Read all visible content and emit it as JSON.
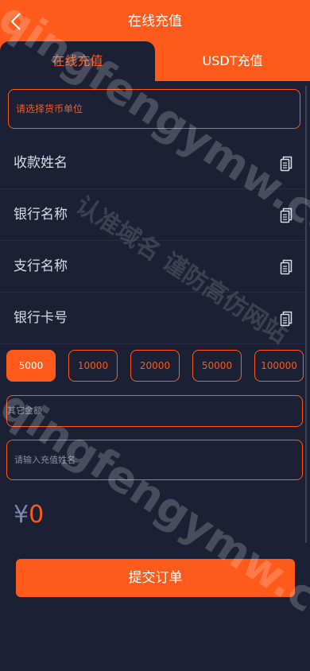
{
  "header": {
    "title": "在线充值",
    "back_icon": "chevron-left-icon",
    "tabs": [
      {
        "label": "在线充值",
        "active": true
      },
      {
        "label": "USDT充值",
        "active": false
      }
    ]
  },
  "form": {
    "currency_placeholder": "请选择货币单位",
    "info_rows": [
      {
        "label": "收款姓名",
        "icon": "copy-icon"
      },
      {
        "label": "银行名称",
        "icon": "copy-icon"
      },
      {
        "label": "支行名称",
        "icon": "copy-icon"
      },
      {
        "label": "银行卡号",
        "icon": "copy-icon"
      }
    ],
    "amounts": [
      "5000",
      "10000",
      "20000",
      "50000",
      "100000"
    ],
    "selected_amount": "5000",
    "other_amount_placeholder": "其它金额",
    "name_placeholder": "请输入充值姓名",
    "currency_symbol": "¥",
    "total": "0",
    "submit_label": "提交订单"
  },
  "watermark": {
    "line1": "qingfengymw.com",
    "line2": "认准域名 谨防高仿网站",
    "line3": "qingfengymw.com"
  },
  "colors": {
    "accent": "#fd5a1c",
    "background": "#1b2034",
    "divider": "#272d43"
  }
}
